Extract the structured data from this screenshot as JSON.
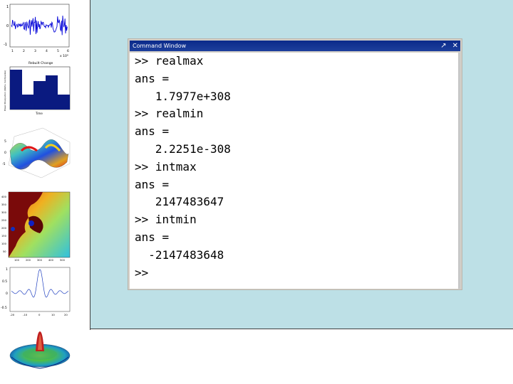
{
  "thumbnails": {
    "plot1": {
      "ytick_top": "1",
      "ytick_mid": "0",
      "ytick_bot": "-1",
      "xticks": [
        "1",
        "2",
        "3",
        "4",
        "5",
        "6"
      ],
      "exponent": "x 10⁴"
    },
    "bar_plot": {
      "title": "Rebuilt Change",
      "ylabel": "Power Dissipation (Watts, Centipedes)",
      "xlabel": "Time"
    },
    "surface": {
      "zticks": [
        "5",
        "0",
        "-5"
      ]
    },
    "fractal": {
      "yticks": [
        "400",
        "350",
        "300",
        "250",
        "200",
        "150",
        "100",
        "50"
      ],
      "xticks": [
        "100",
        "200",
        "300",
        "400",
        "500"
      ]
    },
    "sinc": {
      "yticks": [
        "1",
        "0.5",
        "0",
        "-0.5"
      ],
      "xticks": [
        "-20",
        "-10",
        "0",
        "10",
        "20"
      ]
    }
  },
  "command_window": {
    "title": "Command Window",
    "undock_glyph": "↗",
    "close_glyph": "✕",
    "lines": [
      ">> realmax",
      "ans =",
      "   1.7977e+308",
      ">> realmin",
      "ans =",
      "   2.2251e-308",
      ">> intmax",
      "ans =",
      "   2147483647",
      ">> intmin",
      "ans =",
      "  -2147483648",
      ">>"
    ]
  },
  "colors": {
    "slide_background": "#bde0e6",
    "titlebar": "#0b2a8a",
    "bar_fill": "#0a1a80"
  }
}
